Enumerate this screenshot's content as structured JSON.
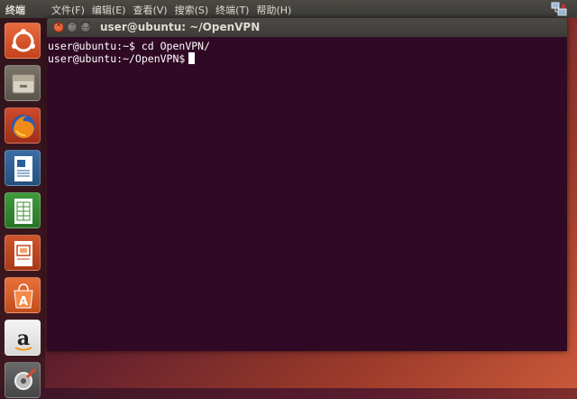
{
  "top_panel": {
    "app_title": "终端",
    "menus": [
      "文件(F)",
      "编辑(E)",
      "查看(V)",
      "搜索(S)",
      "终端(T)",
      "帮助(H)"
    ]
  },
  "window": {
    "title": "user@ubuntu: ~/OpenVPN",
    "buttons": {
      "close": "×",
      "minimize": "–",
      "maximize": "□"
    }
  },
  "terminal": {
    "lines": [
      "user@ubuntu:~$ cd OpenVPN/",
      "user@ubuntu:~/OpenVPN$"
    ],
    "background": "#300a24",
    "foreground": "#ffffff"
  },
  "launcher": {
    "items": [
      "ubuntu-dash-icon",
      "files-icon",
      "firefox-icon",
      "libreoffice-writer-icon",
      "libreoffice-calc-icon",
      "libreoffice-impress-icon",
      "software-center-icon",
      "amazon-icon",
      "system-settings-icon"
    ]
  },
  "colors": {
    "panel": "#3c3b37",
    "accent": "#dd4814"
  }
}
